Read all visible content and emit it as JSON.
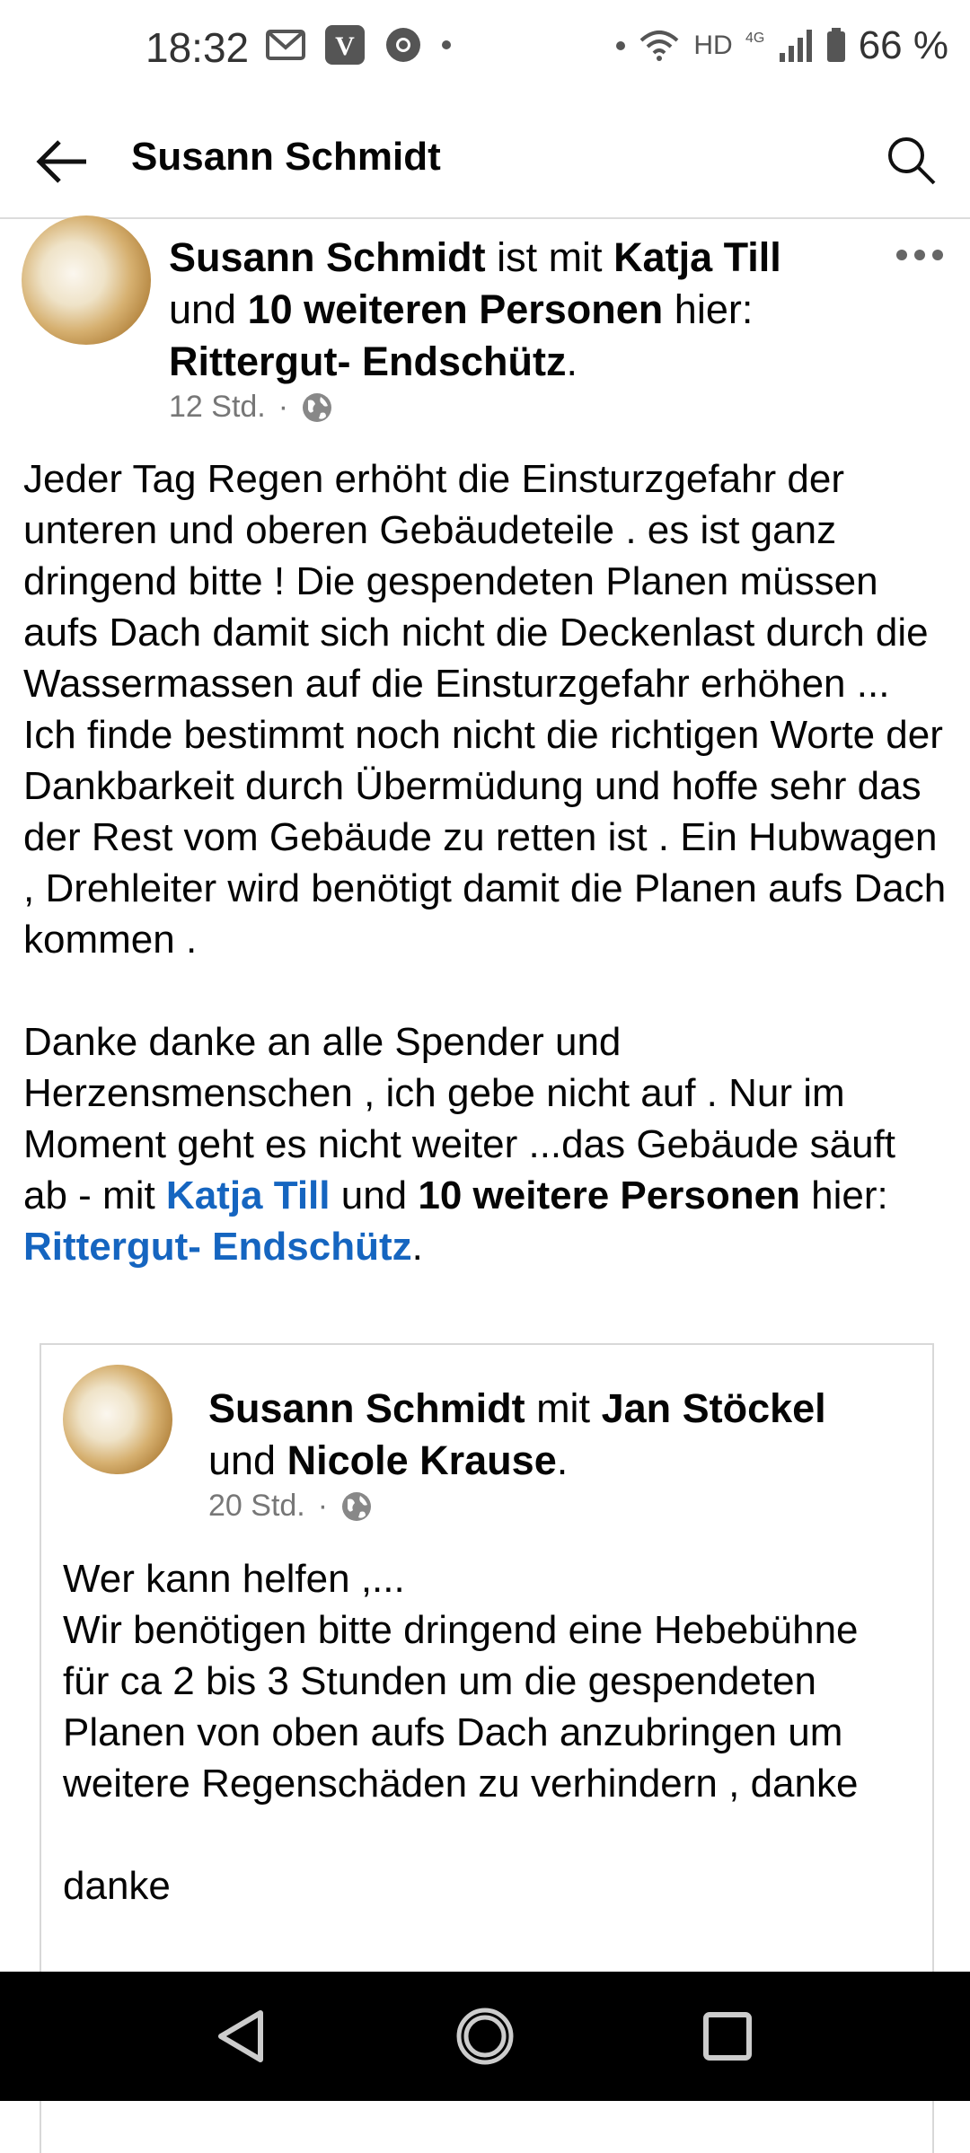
{
  "status_bar": {
    "time": "18:32",
    "battery": "66 %",
    "network": "HD",
    "left_icons": [
      "gmail-icon",
      "v-app-icon",
      "chrome-icon",
      "dot-icon"
    ],
    "right_icons": [
      "dot-icon",
      "wifi-icon",
      "4g-icon",
      "signal-icon",
      "battery-icon"
    ]
  },
  "appbar": {
    "title": "Susann Schmidt"
  },
  "post": {
    "author": "Susann Schmidt",
    "with_text": " ist mit ",
    "tagged_person": "Katja Till",
    "and_text": "und ",
    "others": "10 weiteren Personen",
    "here_text": " hier:",
    "place": "Rittergut- Endschütz",
    "period": ".",
    "time": "12 Std.",
    "separator": "·",
    "paragraph_1": "Jeder Tag Regen erhöht die Einsturzgefahr der unteren und oberen Gebäudeteile . es ist ganz dringend bitte ! Die gespendeten Planen müssen aufs Dach damit sich nicht die Deckenlast durch die Wassermassen auf die Einsturzgefahr erhöhen ...",
    "paragraph_2": "Ich finde bestimmt noch nicht die richtigen Worte der Dankbarkeit durch Übermüdung und hoffe sehr das der Rest vom Gebäude zu retten ist . Ein Hubwagen , Drehleiter wird benötigt damit die Planen aufs Dach kommen .",
    "paragraph_3_start": "Danke danke an alle Spender und Herzensmenschen , ich gebe nicht auf . Nur im Moment geht es nicht weiter ...das Gebäude säuft ab - mit ",
    "p3_tagged": "Katja Till",
    "p3_and": " und ",
    "p3_others": "10 weitere Personen",
    "p3_here": " hier: ",
    "p3_place": "Rittergut- Endschütz",
    "p3_period": "."
  },
  "shared_post": {
    "author": "Susann Schmidt",
    "with_text": " mit ",
    "person_1": "Jan Stöckel",
    "and_text": "und ",
    "person_2": "Nicole Krause",
    "period": ".",
    "time": "20 Std.",
    "separator": "·",
    "line_1": "Wer kann helfen ,...",
    "line_2": "Wir benötigen bitte dringend eine Hebebühne für  ca 2 bis 3 Stunden um die gespendeten Planen von oben aufs Dach anzubringen  um weitere Regenschäden zu verhindern , danke",
    "line_3": "danke"
  }
}
